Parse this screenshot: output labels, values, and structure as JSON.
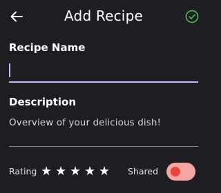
{
  "header": {
    "title": "Add Recipe",
    "back_icon": "arrow-left-icon",
    "save_icon": "check-circle-icon",
    "accent_color": "#4caf50"
  },
  "form": {
    "name_label": "Recipe Name",
    "name_value": "",
    "description_label": "Description",
    "description_placeholder": "Overview of your delicious dish!"
  },
  "footer": {
    "rating_label": "Rating",
    "rating_stars": 5,
    "shared_label": "Shared",
    "shared_on": true,
    "toggle_color": "#e8443f"
  }
}
